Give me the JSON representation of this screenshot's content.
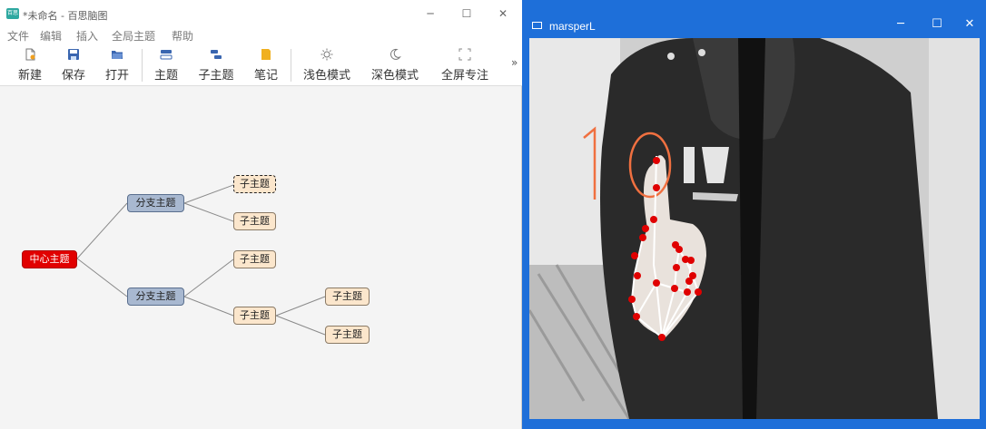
{
  "mindmap": {
    "window_title": "*未命名 - 百思脑图",
    "app_icon_text": "百思",
    "window_controls": {
      "minimize": "─",
      "maximize": "☐",
      "close": "✕"
    },
    "menu": [
      "文件",
      "编辑",
      "插入",
      "全局主题",
      "帮助"
    ],
    "toolbar": {
      "new": "新建",
      "save": "保存",
      "open": "打开",
      "topic": "主题",
      "subtopic": "子主题",
      "note": "笔记",
      "light_mode": "浅色模式",
      "dark_mode": "深色模式",
      "fullscreen": "全屏专注",
      "overflow": "»"
    },
    "nodes": {
      "root": "中心主题",
      "branch1": "分支主题",
      "branch2": "分支主题",
      "b1_sub1": "子主题",
      "b1_sub2": "子主题",
      "b2_sub1": "子主题",
      "b2_sub2": "子主题",
      "b2_sub2_child1": "子主题",
      "b2_sub2_child2": "子主题"
    },
    "colors": {
      "root": "#e10000",
      "branch": "#a8b8d0",
      "subtopic": "#fbe6cc"
    }
  },
  "camera": {
    "window_title": "marsperL",
    "window_controls": {
      "minimize": "─",
      "maximize": "☐",
      "close": "✕"
    },
    "finger_count": "1",
    "colors": {
      "titlebar": "#1e6fd9",
      "overlay_digit": "#f07040",
      "landmark": "#e00000",
      "connector": "#ffffff"
    }
  }
}
